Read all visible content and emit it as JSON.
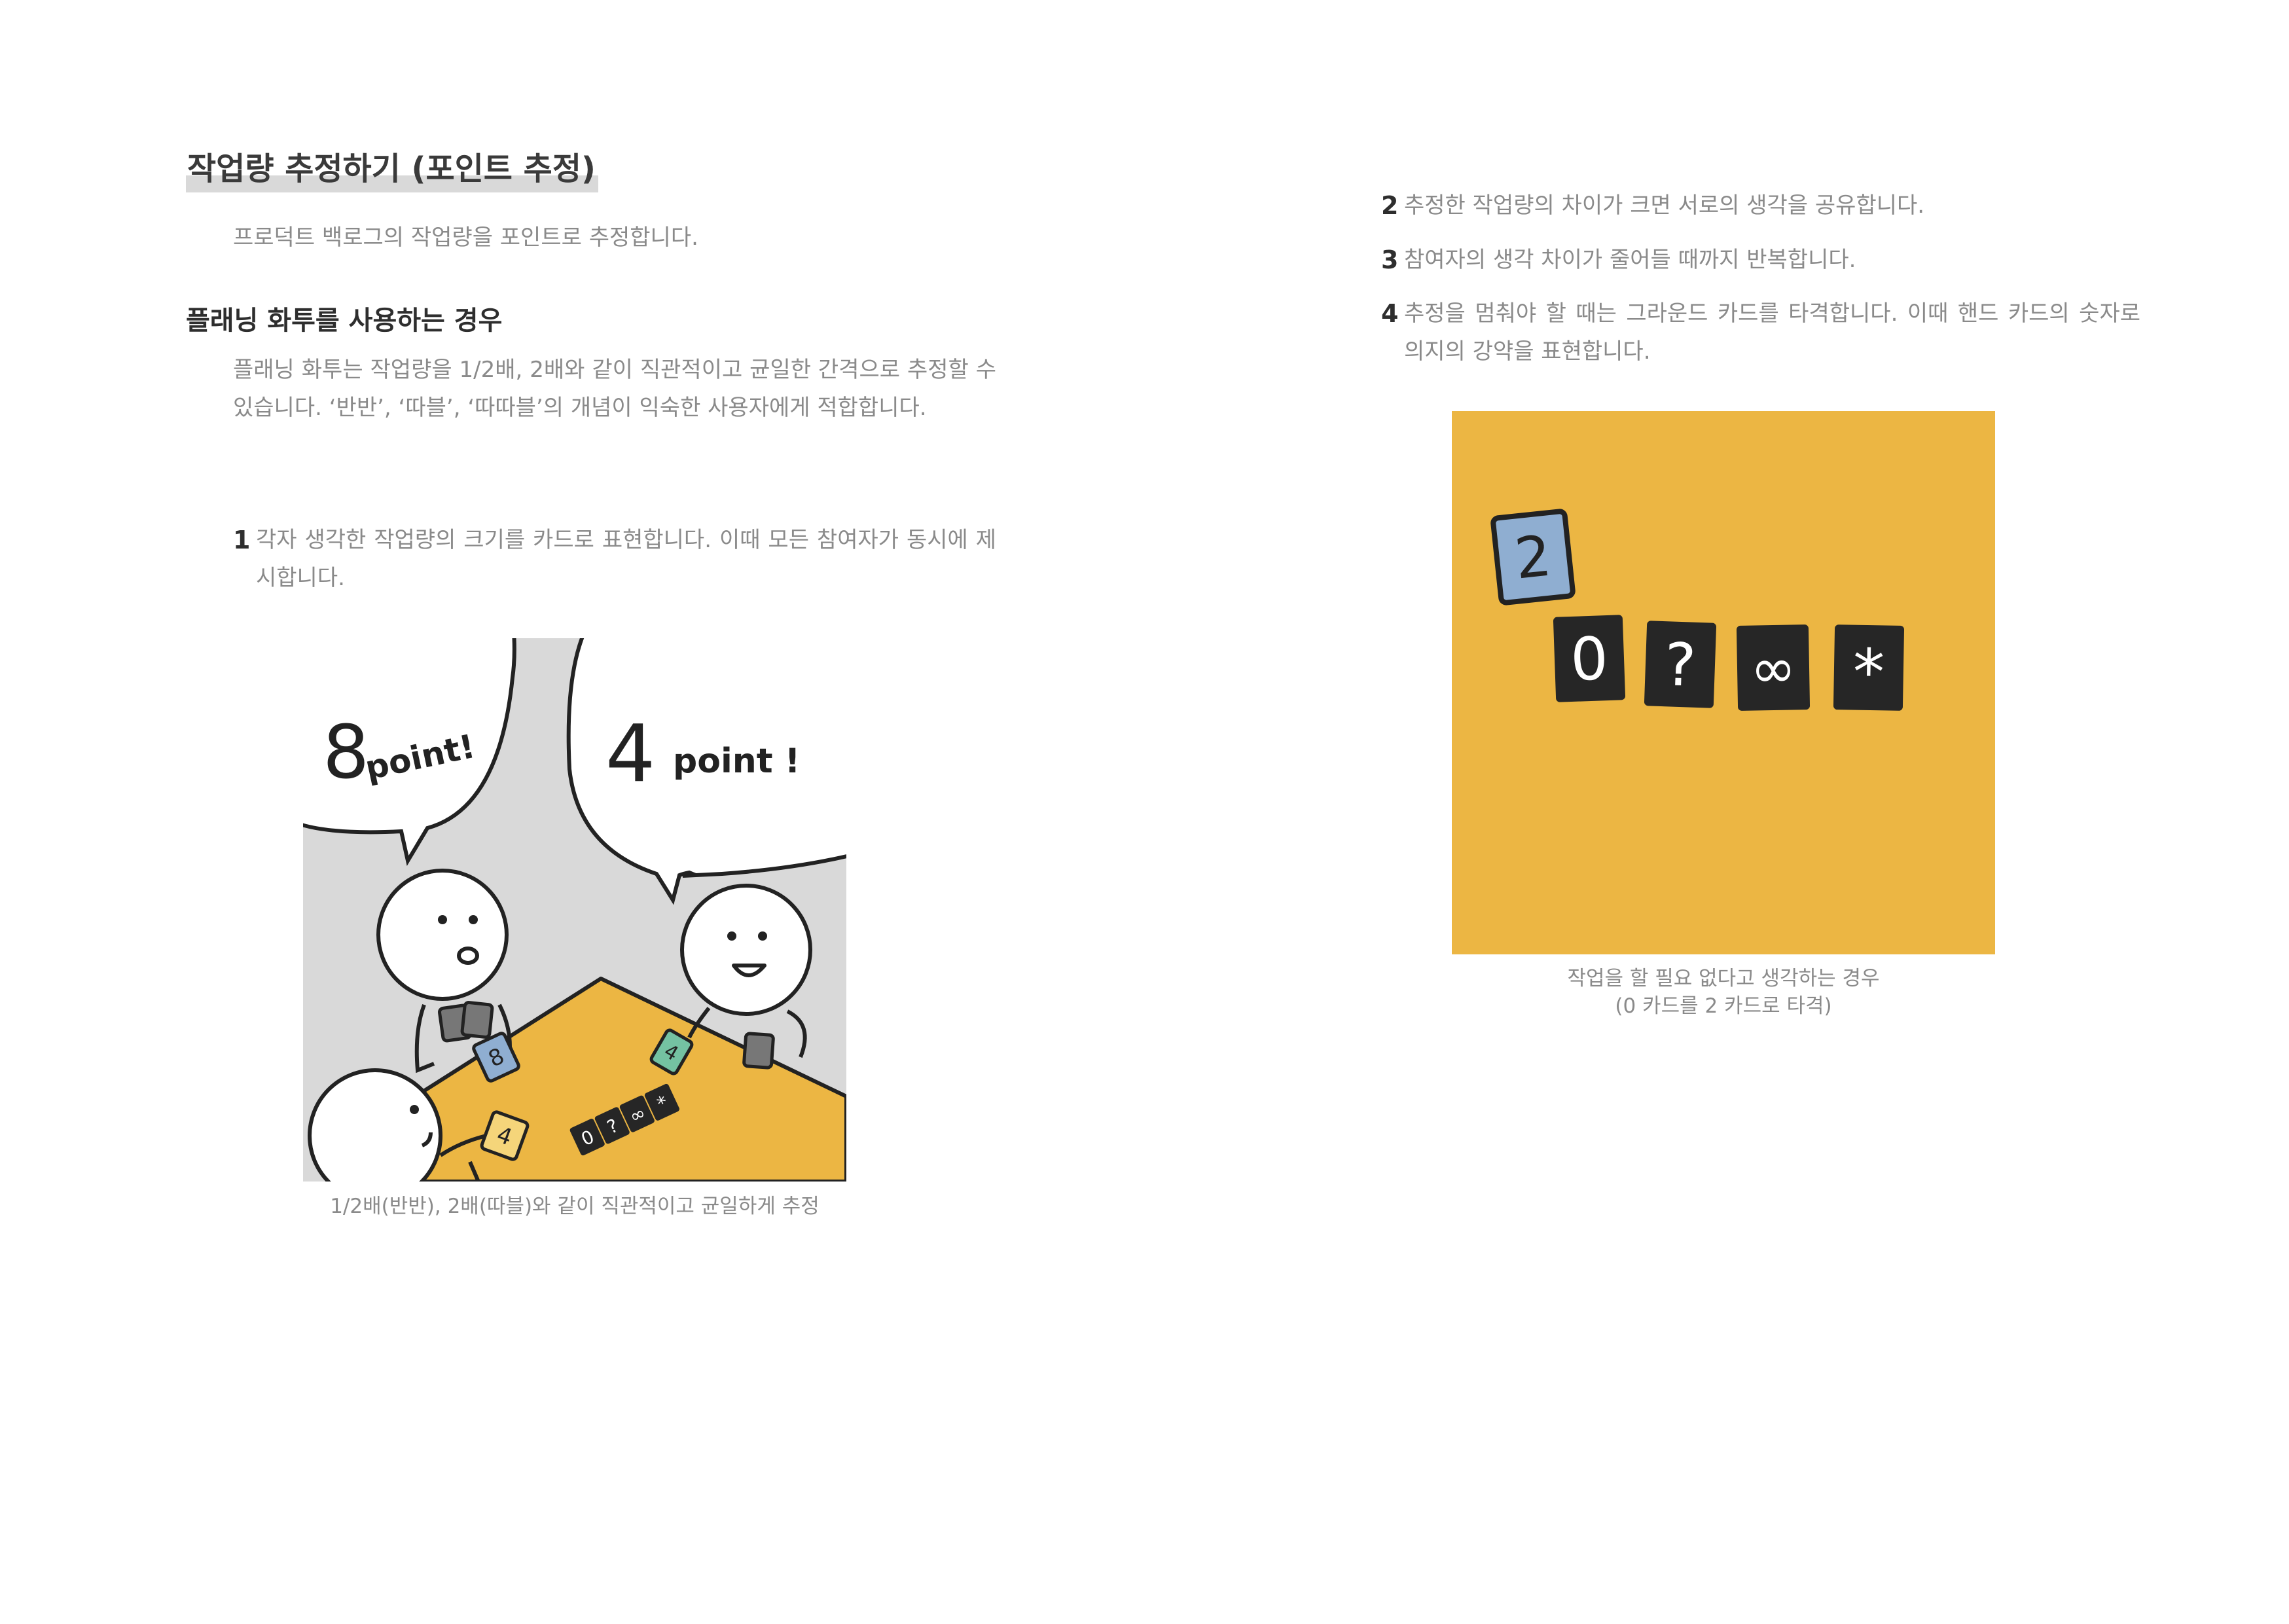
{
  "section_title": "작업량 추정하기 (포인트 추정)",
  "intro": "프로덕트 백로그의 작업량을 포인트로 추정합니다.",
  "subhead": "플래닝 화투를 사용하는 경우",
  "paragraph": "플래닝 화투는 작업량을 1/2배, 2배와 같이 직관적이고 균일한 간격으로 추정할 수 있습니다. ‘반반’, ‘따블’, ‘따따블’의 개념이 익숙한 사용자에게 적합합니다.",
  "steps": [
    {
      "num": "1",
      "text": "각자 생각한 작업량의 크기를 카드로 표현합니다. 이때 모든 참여자가 동시에 제시합니다."
    },
    {
      "num": "2",
      "text": "추정한 작업량의 차이가 크면 서로의 생각을 공유합니다."
    },
    {
      "num": "3",
      "text": "참여자의 생각 차이가 줄어들 때까지 반복합니다."
    },
    {
      "num": "4",
      "text": "추정을 멈춰야 할 때는 그라운드 카드를 타격합니다. 이때 핸드 카드의 숫자로 의지의 강약을 표현합니다."
    }
  ],
  "illustration_left": {
    "bubble_left": {
      "num": "8",
      "word": "point!"
    },
    "bubble_right": {
      "num": "4",
      "word": "point !"
    },
    "table_cards": [
      "0",
      "?",
      "∞",
      "*"
    ],
    "held_cards": [
      "8",
      "4",
      "4"
    ],
    "caption": "1/2배(반반), 2배(따블)와 같이 직관적이고 균일하게 추정"
  },
  "illustration_right": {
    "hand_card": "2",
    "ground_cards": [
      "0",
      "?",
      "∞",
      "*"
    ],
    "caption_line1": "작업을 할 필요 없다고 생각하는 경우",
    "caption_line2": "(0 카드를 2 카드로 타격)"
  },
  "colors": {
    "mustard": "#ecb643",
    "blue_card": "#8faed1",
    "green_card": "#74c2a2",
    "dark_card": "#262626",
    "gray_bg": "#d9d9d9"
  }
}
